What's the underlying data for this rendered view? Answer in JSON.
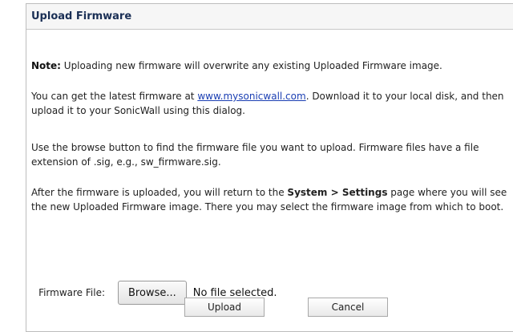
{
  "dialog": {
    "title": "Upload Firmware"
  },
  "content": {
    "note_label": "Note:",
    "note_text": " Uploading new firmware will overwrite any existing Uploaded Firmware image.",
    "p2_before_link": "You can get the latest firmware at ",
    "p2_link": "www.mysonicwall.com",
    "p2_after_link": ". Download it to your local disk, and then upload it to your SonicWall using this dialog.",
    "p3": "Use the browse button to find the firmware file you want to upload. Firmware files have a file extension of .sig, e.g., sw_firmware.sig.",
    "p4_before": "After the firmware is uploaded, you will return to the ",
    "p4_bold": "System > Settings",
    "p4_after": " page where you will see the new Uploaded Firmware image. There you may select the firmware image from which to boot."
  },
  "file": {
    "label": "Firmware File:",
    "browse_label": "Browse...",
    "status": "No file selected."
  },
  "buttons": {
    "upload": "Upload",
    "cancel": "Cancel"
  }
}
